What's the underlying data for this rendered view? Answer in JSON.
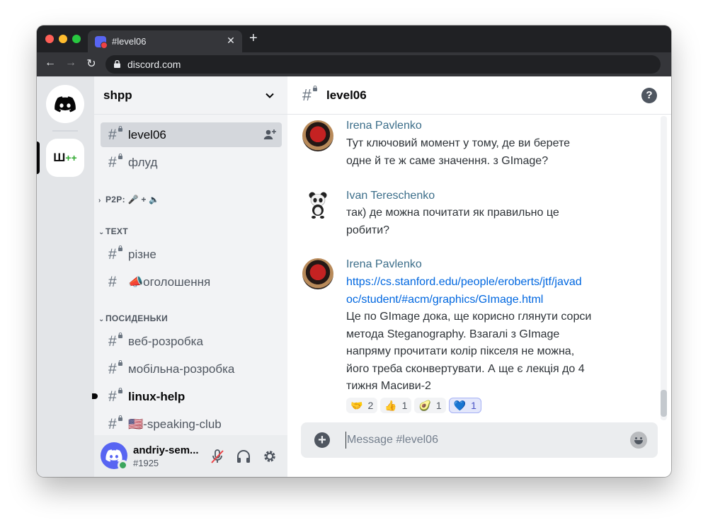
{
  "browser": {
    "tab_title": "#level06",
    "tab_close": "✕",
    "new_tab": "+",
    "url": "discord.com"
  },
  "guilds": {
    "home_icon": "discord-logo-icon",
    "server_label_main": "Ш",
    "server_label_plus": "++"
  },
  "sidebar": {
    "server_name": "shpp",
    "channels_top": [
      {
        "name": "level06",
        "active": true
      },
      {
        "name": "флуд"
      }
    ],
    "categories": [
      {
        "label": "P2P: 🎤 + 🔈",
        "collapsed": true
      },
      {
        "label": "TEXT"
      },
      {
        "label": "ПОСИДЕНЬКИ"
      }
    ],
    "text_channels": [
      {
        "name": "різне"
      },
      {
        "name": "📣оголошення"
      }
    ],
    "posydenky_channels": [
      {
        "name": "веб-розробка"
      },
      {
        "name": "мобільна-розробка"
      },
      {
        "name": "linux-help",
        "unread": true
      },
      {
        "name": "🇺🇸-speaking-club"
      }
    ]
  },
  "user_panel": {
    "username": "andriy-sem...",
    "discriminator": "#1925",
    "status_color": "#3ba55d"
  },
  "chat": {
    "channel_name": "level06",
    "help_label": "?",
    "messages": [
      {
        "author": "Irena Pavlenko",
        "lines": [
          "Тут ключовий момент у тому, де ви берете",
          "одне й те ж саме значення. з GImage?"
        ]
      },
      {
        "author": "Ivan Tereschenko",
        "lines": [
          "так) де можна почитати як правильно це",
          "робити?"
        ]
      },
      {
        "author": "Irena Pavlenko",
        "link_lines": [
          "https://cs.stanford.edu/people/eroberts/jtf/javad",
          "oc/student/#acm/graphics/GImage.html"
        ],
        "lines": [
          "Це по GImage дока, ще корисно глянути сорси",
          "метода Steganography. Взагалі з GImage",
          "напряму прочитати колір пікселя не можна,",
          "його треба сконвертувати. А ще є лекція до 4",
          "тижня Масиви-2"
        ]
      }
    ],
    "reactions": [
      {
        "emoji": "🤝",
        "count": "2"
      },
      {
        "emoji": "👍",
        "count": "1"
      },
      {
        "emoji": "🥑",
        "count": "1"
      },
      {
        "emoji": "💙",
        "count": "1",
        "me": true
      }
    ],
    "composer_placeholder": "Message #level06"
  },
  "colors": {
    "accent": "#5865f2",
    "link": "#0067e0",
    "author": "#3c6e8a"
  }
}
